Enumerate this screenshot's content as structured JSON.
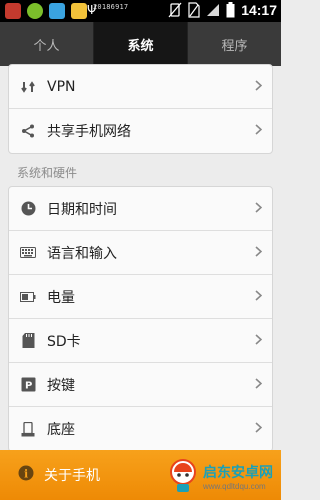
{
  "status_bar": {
    "time": "14:17",
    "notification_text": "20186917",
    "icons": [
      "app-icon-1",
      "app-icon-2",
      "app-icon-3",
      "app-icon-4",
      "usb-icon",
      "vibrate-icon",
      "no-sim-icon",
      "signal-icon",
      "battery-icon"
    ]
  },
  "tabs": [
    {
      "label": "个人",
      "active": false
    },
    {
      "label": "系统",
      "active": true
    },
    {
      "label": "程序",
      "active": false
    }
  ],
  "network_group": [
    {
      "label": "VPN",
      "icon": "vpn-icon"
    },
    {
      "label": "共享手机网络",
      "icon": "share-icon"
    }
  ],
  "section_title": "系统和硬件",
  "system_group": [
    {
      "label": "日期和时间",
      "icon": "clock-icon"
    },
    {
      "label": "语言和输入",
      "icon": "keyboard-icon"
    },
    {
      "label": "电量",
      "icon": "battery-icon"
    },
    {
      "label": "SD卡",
      "icon": "sd-card-icon"
    },
    {
      "label": "按键",
      "icon": "key-icon"
    },
    {
      "label": "底座",
      "icon": "dock-icon"
    }
  ],
  "about": {
    "label": "关于手机",
    "icon": "info-icon"
  },
  "watermark": {
    "title": "启东安卓网",
    "url": "www.qdltdqu.com"
  },
  "colors": {
    "accent": "#f29411",
    "tab_active": "#161616",
    "status_bar": "#000000"
  }
}
